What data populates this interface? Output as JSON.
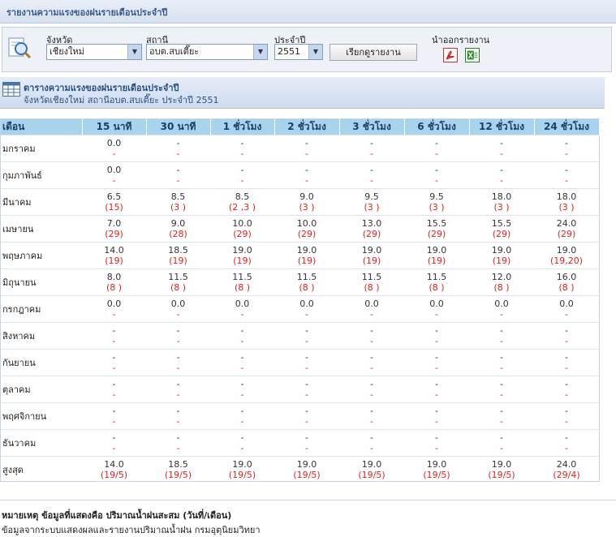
{
  "page_title": "รายงานความแรงของฝนรายเดือนประจำปี",
  "filters": {
    "province_label": "จังหวัด",
    "province_value": "เชียงใหม่",
    "station_label": "สถานี",
    "station_value": "อบต.สบเตี๊ยะ",
    "year_label": "ประจำปี",
    "year_value": "2551",
    "search_button": "เรียกดูรายงาน",
    "export_label": "นำออกรายงาน"
  },
  "table": {
    "title": "ตารางความแรงของฝนรายเดือนประจำปี",
    "subtitle": "จังหวัดเชียงใหม่ สถานีอบต.สบเตี๊ยะ ประจำปี 2551",
    "columns": [
      "เดือน",
      "15 นาที",
      "30 นาที",
      "1 ชั่วโมง",
      "2 ชั่วโมง",
      "3 ชั่วโมง",
      "6 ชั่วโมง",
      "12 ชั่วโมง",
      "24 ชั่วโมง"
    ],
    "rows": [
      {
        "month": "มกราคม",
        "cells": [
          [
            "0.0",
            "-"
          ],
          [
            "-",
            "-"
          ],
          [
            "-",
            "-"
          ],
          [
            "-",
            "-"
          ],
          [
            "-",
            "-"
          ],
          [
            "-",
            "-"
          ],
          [
            "-",
            "-"
          ],
          [
            "-",
            "-"
          ]
        ]
      },
      {
        "month": "กุมภาพันธ์",
        "cells": [
          [
            "0.0",
            "-"
          ],
          [
            "-",
            "-"
          ],
          [
            "-",
            "-"
          ],
          [
            "-",
            "-"
          ],
          [
            "-",
            "-"
          ],
          [
            "-",
            "-"
          ],
          [
            "-",
            "-"
          ],
          [
            "-",
            "-"
          ]
        ]
      },
      {
        "month": "มีนาคม",
        "cells": [
          [
            "6.5",
            "(15)"
          ],
          [
            "8.5",
            "(3 )"
          ],
          [
            "8.5",
            "(2 ,3 )"
          ],
          [
            "9.0",
            "(3 )"
          ],
          [
            "9.5",
            "(3 )"
          ],
          [
            "9.5",
            "(3 )"
          ],
          [
            "18.0",
            "(3 )"
          ],
          [
            "18.0",
            "(3 )"
          ]
        ]
      },
      {
        "month": "เมษายน",
        "cells": [
          [
            "7.0",
            "(29)"
          ],
          [
            "9.0",
            "(28)"
          ],
          [
            "10.0",
            "(29)"
          ],
          [
            "10.0",
            "(29)"
          ],
          [
            "13.0",
            "(29)"
          ],
          [
            "15.5",
            "(29)"
          ],
          [
            "15.5",
            "(29)"
          ],
          [
            "24.0",
            "(29)"
          ]
        ]
      },
      {
        "month": "พฤษภาคม",
        "cells": [
          [
            "14.0",
            "(19)"
          ],
          [
            "18.5",
            "(19)"
          ],
          [
            "19.0",
            "(19)"
          ],
          [
            "19.0",
            "(19)"
          ],
          [
            "19.0",
            "(19)"
          ],
          [
            "19.0",
            "(19)"
          ],
          [
            "19.0",
            "(19)"
          ],
          [
            "19.0",
            "(19,20)"
          ]
        ]
      },
      {
        "month": "มิถุนายน",
        "cells": [
          [
            "8.0",
            "(8 )"
          ],
          [
            "11.5",
            "(8 )"
          ],
          [
            "11.5",
            "(8 )"
          ],
          [
            "11.5",
            "(8 )"
          ],
          [
            "11.5",
            "(8 )"
          ],
          [
            "11.5",
            "(8 )"
          ],
          [
            "12.0",
            "(8 )"
          ],
          [
            "16.0",
            "(8 )"
          ]
        ]
      },
      {
        "month": "กรกฎาคม",
        "cells": [
          [
            "0.0",
            "-"
          ],
          [
            "0.0",
            "-"
          ],
          [
            "0.0",
            "-"
          ],
          [
            "0.0",
            "-"
          ],
          [
            "0.0",
            "-"
          ],
          [
            "0.0",
            "-"
          ],
          [
            "0.0",
            "-"
          ],
          [
            "0.0",
            "-"
          ]
        ]
      },
      {
        "month": "สิงหาคม",
        "cells": [
          [
            "-",
            "-"
          ],
          [
            "-",
            "-"
          ],
          [
            "-",
            "-"
          ],
          [
            "-",
            "-"
          ],
          [
            "-",
            "-"
          ],
          [
            "-",
            "-"
          ],
          [
            "-",
            "-"
          ],
          [
            "-",
            "-"
          ]
        ]
      },
      {
        "month": "กันยายน",
        "cells": [
          [
            "-",
            "-"
          ],
          [
            "-",
            "-"
          ],
          [
            "-",
            "-"
          ],
          [
            "-",
            "-"
          ],
          [
            "-",
            "-"
          ],
          [
            "-",
            "-"
          ],
          [
            "-",
            "-"
          ],
          [
            "-",
            "-"
          ]
        ]
      },
      {
        "month": "ตุลาคม",
        "cells": [
          [
            "-",
            "-"
          ],
          [
            "-",
            "-"
          ],
          [
            "-",
            "-"
          ],
          [
            "-",
            "-"
          ],
          [
            "-",
            "-"
          ],
          [
            "-",
            "-"
          ],
          [
            "-",
            "-"
          ],
          [
            "-",
            "-"
          ]
        ]
      },
      {
        "month": "พฤศจิกายน",
        "cells": [
          [
            "-",
            "-"
          ],
          [
            "-",
            "-"
          ],
          [
            "-",
            "-"
          ],
          [
            "-",
            "-"
          ],
          [
            "-",
            "-"
          ],
          [
            "-",
            "-"
          ],
          [
            "-",
            "-"
          ],
          [
            "-",
            "-"
          ]
        ]
      },
      {
        "month": "ธันวาคม",
        "cells": [
          [
            "-",
            "-"
          ],
          [
            "-",
            "-"
          ],
          [
            "-",
            "-"
          ],
          [
            "-",
            "-"
          ],
          [
            "-",
            "-"
          ],
          [
            "-",
            "-"
          ],
          [
            "-",
            "-"
          ],
          [
            "-",
            "-"
          ]
        ]
      },
      {
        "month": "สูงสุด",
        "cells": [
          [
            "14.0",
            "(19/5)"
          ],
          [
            "18.5",
            "(19/5)"
          ],
          [
            "19.0",
            "(19/5)"
          ],
          [
            "19.0",
            "(19/5)"
          ],
          [
            "19.0",
            "(19/5)"
          ],
          [
            "19.0",
            "(19/5)"
          ],
          [
            "19.0",
            "(19/5)"
          ],
          [
            "24.0",
            "(29/4)"
          ]
        ]
      }
    ]
  },
  "note": {
    "line1": "หมายเหตุ ข้อมูลที่แสดงคือ ปริมาณน้ำฝนสะสม (วันที่/เดือน)",
    "line2": "ข้อมูลจากระบบแสดงผลและรายงานปริมาณน้ำฝน กรมอุตุนิยมวิทยา"
  },
  "icons": {
    "report": "magnifier-report-icon",
    "pdf": "pdf-icon",
    "excel": "excel-icon",
    "table": "table-icon"
  },
  "colors": {
    "header_text": "#3a5a8c",
    "table_header_bg": "#a7d3ec",
    "date_text": "#dd2222"
  }
}
